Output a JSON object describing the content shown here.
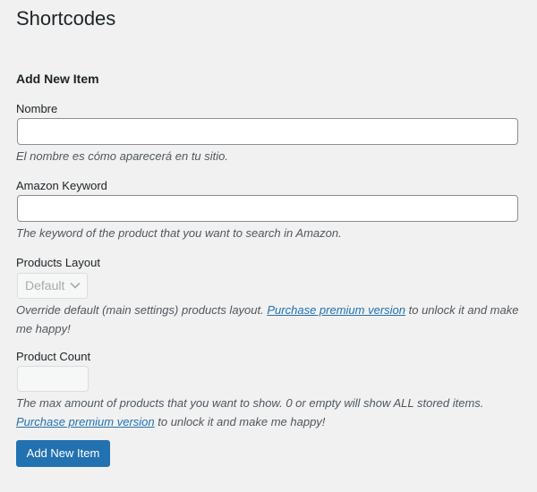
{
  "page": {
    "title": "Shortcodes"
  },
  "form": {
    "section_title": "Add New Item",
    "name": {
      "label": "Nombre",
      "value": "",
      "description": "El nombre es cómo aparecerá en tu sitio."
    },
    "keyword": {
      "label": "Amazon Keyword",
      "value": "",
      "description": "The keyword of the product that you want to search in Amazon."
    },
    "layout": {
      "label": "Products Layout",
      "selected": "Default",
      "disabled": true,
      "description_before": "Override default (main settings) products layout.",
      "link_text": "Purchase premium version",
      "description_after": "to unlock it and make me happy!"
    },
    "count": {
      "label": "Product Count",
      "value": "",
      "disabled": true,
      "description_before": "The max amount of products that you want to show. 0 or empty will show ALL stored items.",
      "link_text": "Purchase premium version",
      "description_after": "to unlock it and make me happy!"
    },
    "submit_label": "Add New Item"
  },
  "colors": {
    "background": "#f1f1f1",
    "primary": "#2271b1",
    "link": "#2271b1",
    "description_text": "#50575e",
    "disabled_text": "#a7aaad"
  },
  "icons": {
    "select_arrow": "chevron-down-icon"
  }
}
